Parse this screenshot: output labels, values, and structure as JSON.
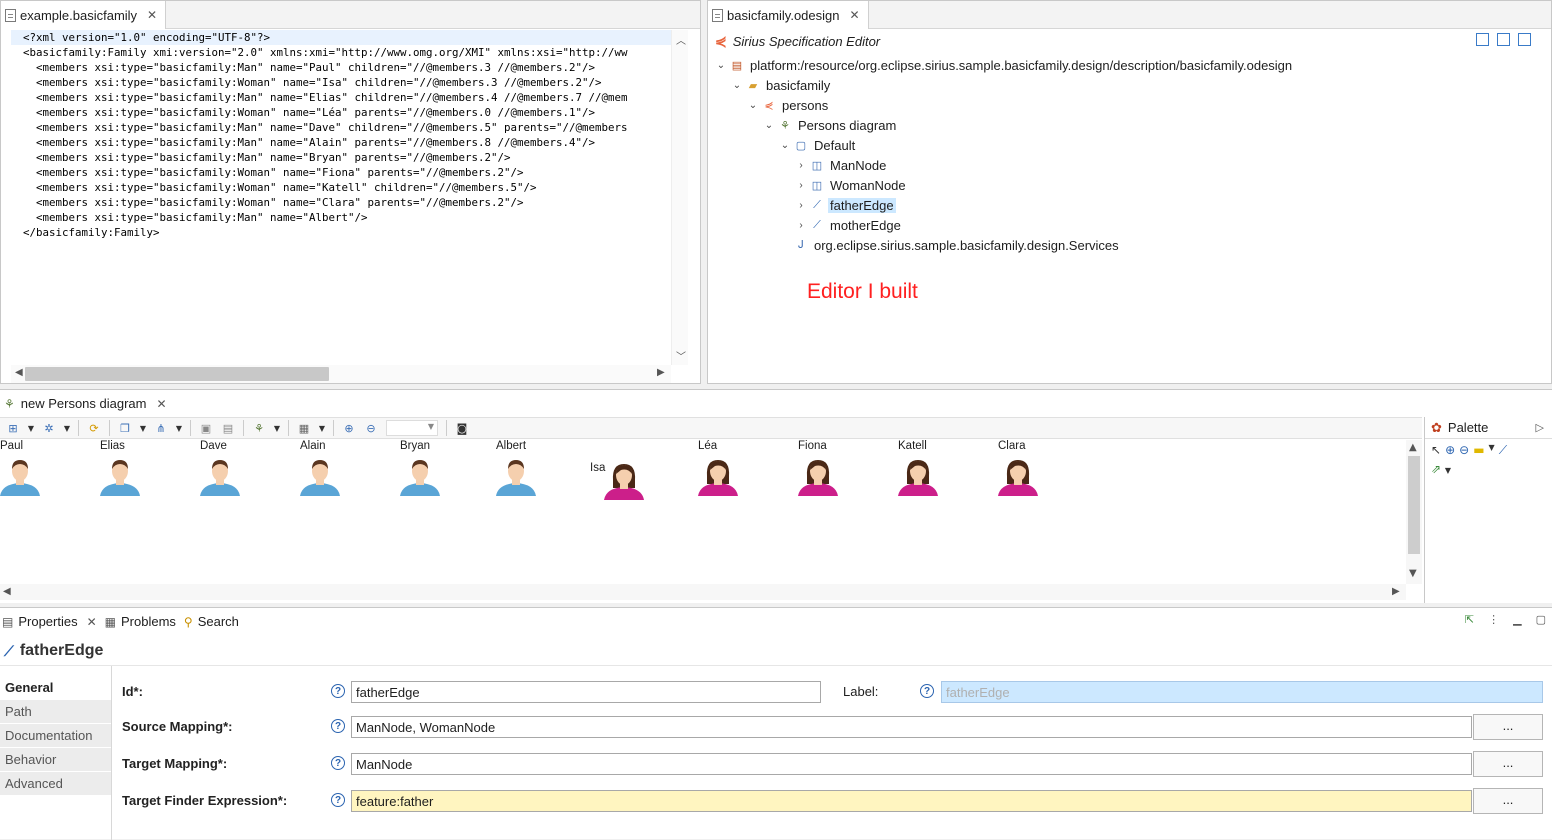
{
  "xml_editor": {
    "tab_title": "example.basicfamily",
    "lines": [
      "<?xml version=\"1.0\" encoding=\"UTF-8\"?>",
      "<basicfamily:Family xmi:version=\"2.0\" xmlns:xmi=\"http://www.omg.org/XMI\" xmlns:xsi=\"http://ww",
      "  <members xsi:type=\"basicfamily:Man\" name=\"Paul\" children=\"//@members.3 //@members.2\"/>",
      "  <members xsi:type=\"basicfamily:Woman\" name=\"Isa\" children=\"//@members.3 //@members.2\"/>",
      "  <members xsi:type=\"basicfamily:Man\" name=\"Elias\" children=\"//@members.4 //@members.7 //@mem",
      "  <members xsi:type=\"basicfamily:Woman\" name=\"Léa\" parents=\"//@members.0 //@members.1\"/>",
      "  <members xsi:type=\"basicfamily:Man\" name=\"Dave\" children=\"//@members.5\" parents=\"//@members",
      "  <members xsi:type=\"basicfamily:Man\" name=\"Alain\" parents=\"//@members.8 //@members.4\"/>",
      "  <members xsi:type=\"basicfamily:Man\" name=\"Bryan\" parents=\"//@members.2\"/>",
      "  <members xsi:type=\"basicfamily:Woman\" name=\"Fiona\" parents=\"//@members.2\"/>",
      "  <members xsi:type=\"basicfamily:Woman\" name=\"Katell\" children=\"//@members.5\"/>",
      "  <members xsi:type=\"basicfamily:Woman\" name=\"Clara\" parents=\"//@members.2\"/>",
      "  <members xsi:type=\"basicfamily:Man\" name=\"Albert\"/>",
      "</basicfamily:Family>"
    ]
  },
  "odesign_editor": {
    "tab_title": "basicfamily.odesign",
    "header": "Sirius Specification Editor",
    "tree": [
      {
        "label": "platform:/resource/org.eclipse.sirius.sample.basicfamily.design/description/basicfamily.odesign",
        "icon": "odesign-file-icon"
      },
      {
        "label": "basicfamily",
        "icon": "folder-icon"
      },
      {
        "label": "persons",
        "icon": "viewpoint-icon"
      },
      {
        "label": "Persons diagram",
        "icon": "diagram-icon"
      },
      {
        "label": "Default",
        "icon": "layer-icon"
      },
      {
        "label": "ManNode",
        "icon": "node-icon"
      },
      {
        "label": "WomanNode",
        "icon": "node-icon"
      },
      {
        "label": "fatherEdge",
        "icon": "edge-icon",
        "selected": true
      },
      {
        "label": "motherEdge",
        "icon": "edge-icon"
      },
      {
        "label": "org.eclipse.sirius.sample.basicfamily.design.Services",
        "icon": "java-class-icon"
      }
    ]
  },
  "annotation": "Editor I built",
  "diagram": {
    "tab_title": "new Persons diagram",
    "palette_title": "Palette",
    "people": [
      {
        "name": "Paul",
        "gender": "man"
      },
      {
        "name": "Elias",
        "gender": "man"
      },
      {
        "name": "Dave",
        "gender": "man"
      },
      {
        "name": "Alain",
        "gender": "man"
      },
      {
        "name": "Bryan",
        "gender": "man"
      },
      {
        "name": "Albert",
        "gender": "man"
      },
      {
        "name": "Isa",
        "gender": "woman"
      },
      {
        "name": "Léa",
        "gender": "woman"
      },
      {
        "name": "Fiona",
        "gender": "woman"
      },
      {
        "name": "Katell",
        "gender": "woman"
      },
      {
        "name": "Clara",
        "gender": "woman"
      }
    ],
    "colors": {
      "man_shirt": "#5aa5d6",
      "woman_shirt": "#cc1f8a",
      "hair_man": "#5a3620",
      "hair_woman": "#4a2816",
      "skin": "#f5cfae"
    }
  },
  "properties": {
    "tabs": [
      "Properties",
      "Problems",
      "Search"
    ],
    "title": "fatherEdge",
    "side_tabs": [
      "General",
      "Path",
      "Documentation",
      "Behavior",
      "Advanced"
    ],
    "fields": {
      "id_label": "Id*:",
      "id_value": "fatherEdge",
      "label_label": "Label:",
      "label_value": "fatherEdge",
      "source_label": "Source Mapping*:",
      "source_value": "ManNode, WomanNode",
      "target_label": "Target Mapping*:",
      "target_value": "ManNode",
      "finder_label": "Target Finder Expression*:",
      "finder_value": "feature:father",
      "browse": "..."
    }
  }
}
